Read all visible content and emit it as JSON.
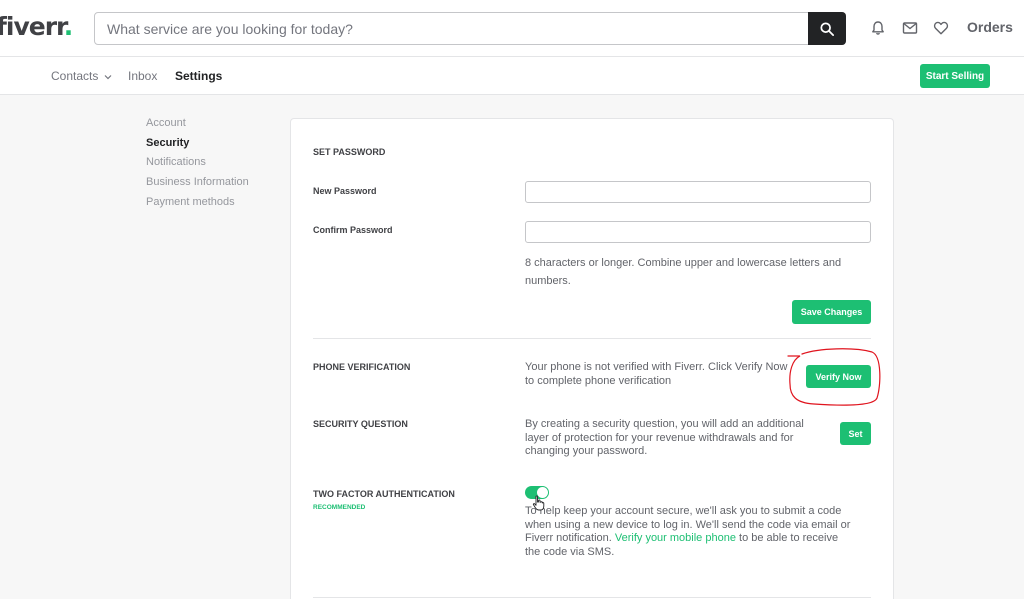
{
  "header": {
    "logo_text": "fiverr",
    "logo_dot": ".",
    "search_placeholder": "What service are you looking for today?",
    "orders_label": "Orders",
    "icons": [
      "search-icon",
      "bell-icon",
      "mail-icon",
      "heart-icon"
    ]
  },
  "subnav": {
    "contacts_label": "Contacts",
    "inbox_label": "Inbox",
    "settings_label": "Settings",
    "start_selling_label": "Start Selling"
  },
  "sidebar": {
    "items": [
      {
        "label": "Account"
      },
      {
        "label": "Security"
      },
      {
        "label": "Notifications"
      },
      {
        "label": "Business Information"
      },
      {
        "label": "Payment methods"
      }
    ]
  },
  "password": {
    "section_title": "SET PASSWORD",
    "new_label": "New Password",
    "new_value": "",
    "confirm_label": "Confirm Password",
    "confirm_value": "",
    "hint_line1": "8 characters or longer. Combine upper and lowercase letters and",
    "hint_line2": "numbers.",
    "save_label": "Save Changes"
  },
  "phone": {
    "title": "PHONE VERIFICATION",
    "line1": "Your phone is not verified with Fiverr. Click Verify Now",
    "line2": "to complete phone verification",
    "button_label": "Verify Now"
  },
  "security_question": {
    "title": "SECURITY QUESTION",
    "line1": "By creating a security question, you will add an additional",
    "line2": "layer of protection for your revenue withdrawals and for",
    "line3": "changing your password.",
    "button_label": "Set"
  },
  "two_factor": {
    "title": "TWO FACTOR AUTHENTICATION",
    "badge": "RECOMMENDED",
    "enabled": true,
    "line1": "To help keep your account secure, we'll ask you to submit a code",
    "line2": "when using a new device to log in. We'll send the code via email or",
    "line3_before": "Fiverr notification.",
    "line3_link": "Verify your mobile phone",
    "line3_after": "to be able to receive",
    "line4": "the code via SMS."
  },
  "colors": {
    "accent": "#1dbf73",
    "annotation": "#e0141e",
    "text": "#404145"
  }
}
